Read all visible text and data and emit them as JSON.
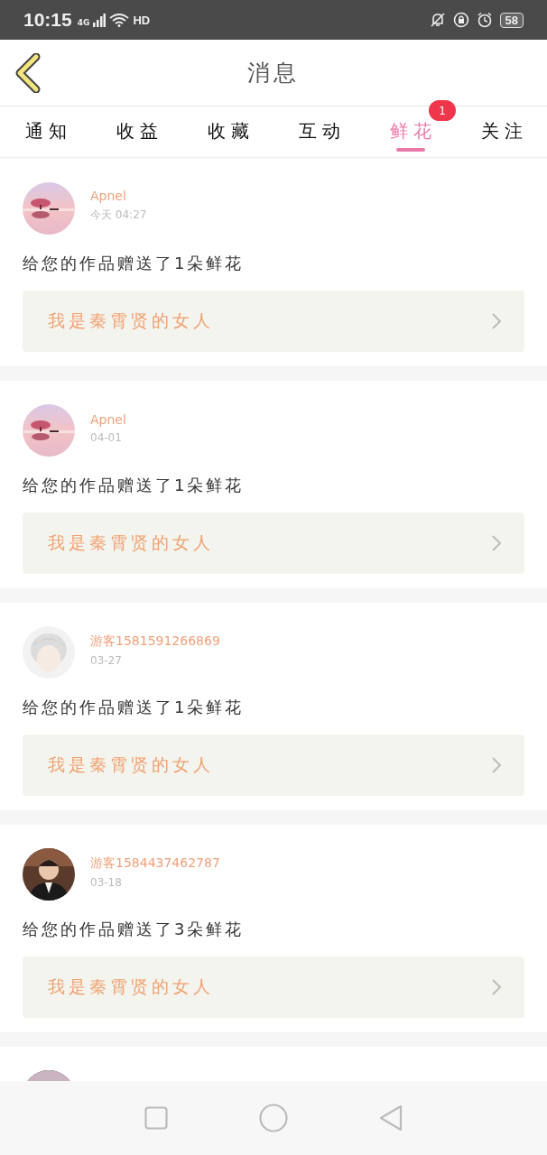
{
  "status_bar": {
    "time": "10:15",
    "network": "4G",
    "call": "HD",
    "battery": "58"
  },
  "header": {
    "title": "消息"
  },
  "tabs": [
    {
      "label": "通知",
      "selected": false
    },
    {
      "label": "收益",
      "selected": false
    },
    {
      "label": "收藏",
      "selected": false
    },
    {
      "label": "互动",
      "selected": false
    },
    {
      "label": "鲜花",
      "selected": true,
      "badge": "1"
    },
    {
      "label": "关注",
      "selected": false
    }
  ],
  "messages": [
    {
      "name": "Apnel",
      "time": "今天 04:27",
      "text": "给您的作品赠送了1朵鲜花",
      "work_title": "我是秦霄贤的女人"
    },
    {
      "name": "Apnel",
      "time": "04-01",
      "text": "给您的作品赠送了1朵鲜花",
      "work_title": "我是秦霄贤的女人"
    },
    {
      "name": "游客1581591266869",
      "time": "03-27",
      "text": "给您的作品赠送了1朵鲜花",
      "work_title": "我是秦霄贤的女人"
    },
    {
      "name": "游客1584437462787",
      "time": "03-18",
      "text": "给您的作品赠送了3朵鲜花",
      "work_title": "我是秦霄贤的女人"
    }
  ]
}
